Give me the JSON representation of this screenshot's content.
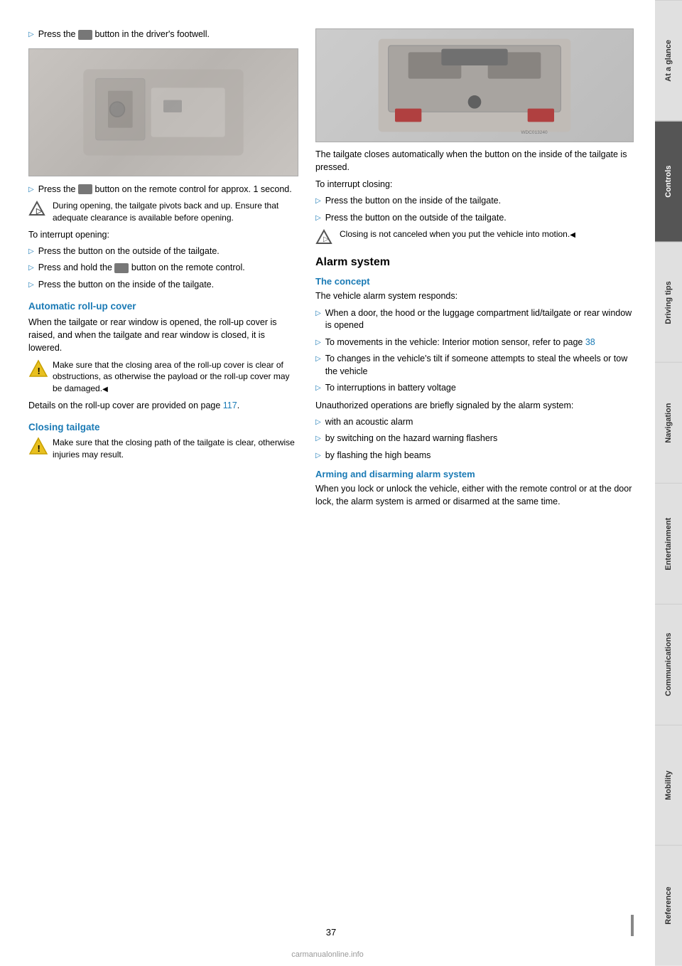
{
  "sidebar": {
    "tabs": [
      {
        "label": "At a glance",
        "active": false
      },
      {
        "label": "Controls",
        "active": true
      },
      {
        "label": "Driving tips",
        "active": false
      },
      {
        "label": "Navigation",
        "active": false
      },
      {
        "label": "Entertainment",
        "active": false
      },
      {
        "label": "Communications",
        "active": false
      },
      {
        "label": "Mobility",
        "active": false
      },
      {
        "label": "Reference",
        "active": false
      }
    ]
  },
  "left_col": {
    "bullet1": {
      "text": "Press the",
      "suffix": "button in the driver's footwell."
    },
    "bullet2": {
      "text": "Press the",
      "suffix": "button on the remote control for approx. 1 second."
    },
    "note_opening": "During opening, the tailgate pivots back and up. Ensure that adequate clearance is available before opening.",
    "interrupt_heading": "To interrupt opening:",
    "interrupt_bullets": [
      "Press the button on the outside of the tailgate.",
      "Press and hold the button on the remote control.",
      "Press the button on the inside of the tailgate."
    ],
    "automatic_rollup": {
      "heading": "Automatic roll-up cover",
      "para": "When the tailgate or rear window is opened, the roll-up cover is raised, and when the tailgate and rear window is closed, it is lowered.",
      "caution": "Make sure that the closing area of the roll-up cover is clear of obstructions, as otherwise the payload or the roll-up cover may be damaged.",
      "details": "Details on the roll-up cover are provided on page 117."
    },
    "closing_tailgate": {
      "heading": "Closing tailgate",
      "caution": "Make sure that the closing path of the tailgate is clear, otherwise injuries may result."
    }
  },
  "right_col": {
    "tailgate_note": "The tailgate closes automatically when the button on the inside of the tailgate is pressed.",
    "interrupt_closing_heading": "To interrupt closing:",
    "interrupt_closing_bullets": [
      "Press the button on the inside of the tailgate.",
      "Press the button on the outside of the tailgate."
    ],
    "closing_note": "Closing is not canceled when you put the vehicle into motion.",
    "alarm_system": {
      "heading": "Alarm system",
      "concept_heading": "The concept",
      "concept_intro": "The vehicle alarm system responds:",
      "concept_bullets": [
        "When a door, the hood or the luggage compartment lid/tailgate or rear window is opened",
        "To movements in the vehicle: Interior motion sensor, refer to page 38",
        "To changes in the vehicle's tilt if someone attempts to steal the wheels or tow the vehicle",
        "To interruptions in battery voltage"
      ],
      "unauthorized_intro": "Unauthorized operations are briefly signaled by the alarm system:",
      "unauthorized_bullets": [
        "with an acoustic alarm",
        "by switching on the hazard warning flashers",
        "by flashing the high beams"
      ],
      "arming_heading": "Arming and disarming alarm system",
      "arming_para": "When you lock or unlock the vehicle, either with the remote control or at the door lock, the alarm system is armed or disarmed at the same time."
    }
  },
  "page_number": "37",
  "watermark": "carmanualonline.info",
  "page_ref_117": "117",
  "page_ref_38": "38"
}
